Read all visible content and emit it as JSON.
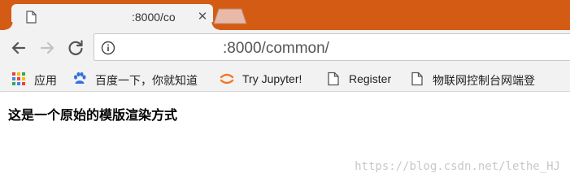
{
  "colors": {
    "titlebar": "#d45b14",
    "toolbar": "#f2f2f2",
    "new_tab": "#e8b9a6"
  },
  "tab": {
    "title": ":8000/co",
    "close_glyph": "✕",
    "favicon": "page-icon"
  },
  "toolbar": {
    "back_icon": "arrow-left-icon",
    "forward_icon": "arrow-right-icon",
    "reload_icon": "reload-icon",
    "info_icon": "info-icon"
  },
  "omnibox": {
    "url": ":8000/common/"
  },
  "bookmarks": [
    {
      "label": "应用",
      "icon": "apps-grid-icon"
    },
    {
      "label": "百度一下，你就知道",
      "icon": "baidu-paw-icon"
    },
    {
      "label": "Try Jupyter!",
      "icon": "jupyter-icon"
    },
    {
      "label": "Register",
      "icon": "page-icon"
    },
    {
      "label": "物联网控制台网端登",
      "icon": "page-icon"
    }
  ],
  "content": {
    "heading": "这是一个原始的模版渲染方式",
    "watermark": "https://blog.csdn.net/lethe_HJ"
  }
}
